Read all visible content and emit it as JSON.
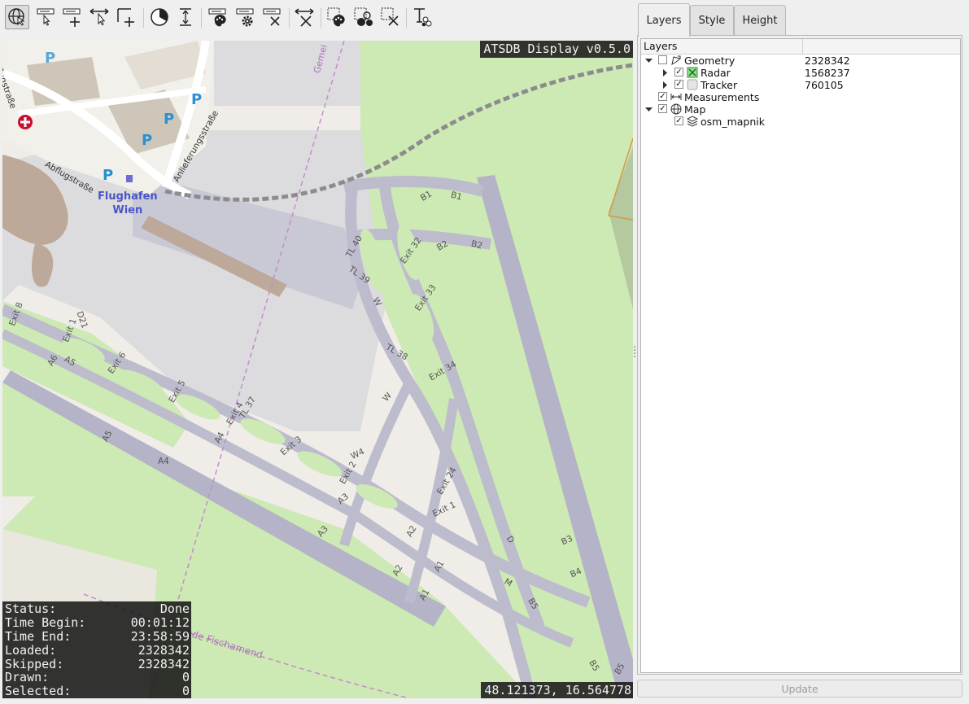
{
  "toolbar": {
    "buttons": [
      {
        "icon": "navigate-icon",
        "active": true
      },
      {
        "icon": "select-icon"
      },
      {
        "icon": "add-point-icon"
      },
      {
        "icon": "move-icon"
      },
      {
        "icon": "add-line-icon"
      },
      {
        "icon": "pie-icon"
      },
      {
        "icon": "distance-icon"
      },
      {
        "icon": "style-icon"
      },
      {
        "icon": "settings-icon"
      },
      {
        "icon": "remove-icon"
      },
      {
        "icon": "clear-icon"
      },
      {
        "icon": "color-select-icon"
      },
      {
        "icon": "invert-select-icon"
      },
      {
        "icon": "deselect-icon"
      },
      {
        "icon": "text-icon"
      }
    ]
  },
  "map": {
    "version_label": "ATSDB Display v0.5.0",
    "coordinates": "48.121373, 16.564778",
    "place_labels": {
      "airport": [
        "Flughafen",
        "Wien"
      ],
      "abflug1": "Abflugstraße",
      "abflug2": "Abflugstraße",
      "anlieferung": "Anlieferungsstraße",
      "gemeinde": "Gemei",
      "fischamend": "nde Fischamend"
    },
    "taxi_labels": [
      "B1",
      "B2",
      "B3",
      "B4",
      "B5",
      "B5",
      "B5",
      "TL 40",
      "TL 39",
      "TL 38",
      "TL 37",
      "Exit 32",
      "Exit 33",
      "Exit 34",
      "Exit 24",
      "Exit 1",
      "Exit 2",
      "Exit 3",
      "Exit 4",
      "Exit 5",
      "Exit 6",
      "Exit 8",
      "Exit 1",
      "W",
      "W",
      "W4",
      "A1",
      "A1",
      "A2",
      "A2",
      "A3",
      "A3",
      "A4",
      "A4",
      "A5",
      "A5",
      "A6",
      "D",
      "D21",
      "M"
    ],
    "status": {
      "rows": [
        {
          "label": "Status:",
          "value": "Done"
        },
        {
          "label": "Time Begin:",
          "value": "00:01:12"
        },
        {
          "label": "Time End:",
          "value": "23:58:59"
        },
        {
          "label": "Loaded:",
          "value": "2328342"
        },
        {
          "label": "Skipped:",
          "value": "2328342"
        },
        {
          "label": "Drawn:",
          "value": "0"
        },
        {
          "label": "Selected:",
          "value": "0"
        }
      ]
    }
  },
  "panel": {
    "tabs": [
      {
        "label": "Layers",
        "active": true
      },
      {
        "label": "Style"
      },
      {
        "label": "Height"
      }
    ],
    "tree": {
      "header": "Layers",
      "rows": [
        {
          "label": "Geometry",
          "value": "2328342",
          "checked": false,
          "expanded": true,
          "depth": 0,
          "icon": "geometry-icon"
        },
        {
          "label": "Radar",
          "value": "1568237",
          "checked": true,
          "expanded": false,
          "depth": 1,
          "icon": "radar-icon"
        },
        {
          "label": "Tracker",
          "value": "760105",
          "checked": true,
          "expanded": false,
          "depth": 1,
          "icon": "tracker-icon"
        },
        {
          "label": "Measurements",
          "value": "",
          "checked": true,
          "expanded": null,
          "depth": 0,
          "icon": "measurements-icon"
        },
        {
          "label": "Map",
          "value": "",
          "checked": true,
          "expanded": true,
          "depth": 0,
          "icon": "globe-icon"
        },
        {
          "label": "osm_mapnik",
          "value": "",
          "checked": true,
          "expanded": null,
          "depth": 1,
          "icon": "layers-icon"
        }
      ]
    },
    "update_label": "Update"
  },
  "colors": {
    "grass": "#cde9b4",
    "taxiway": "#bdbccd",
    "runway": "#b4b3c7",
    "apron": "#dcdcde",
    "terminal": "#bca99a",
    "overlay": "#141414"
  }
}
